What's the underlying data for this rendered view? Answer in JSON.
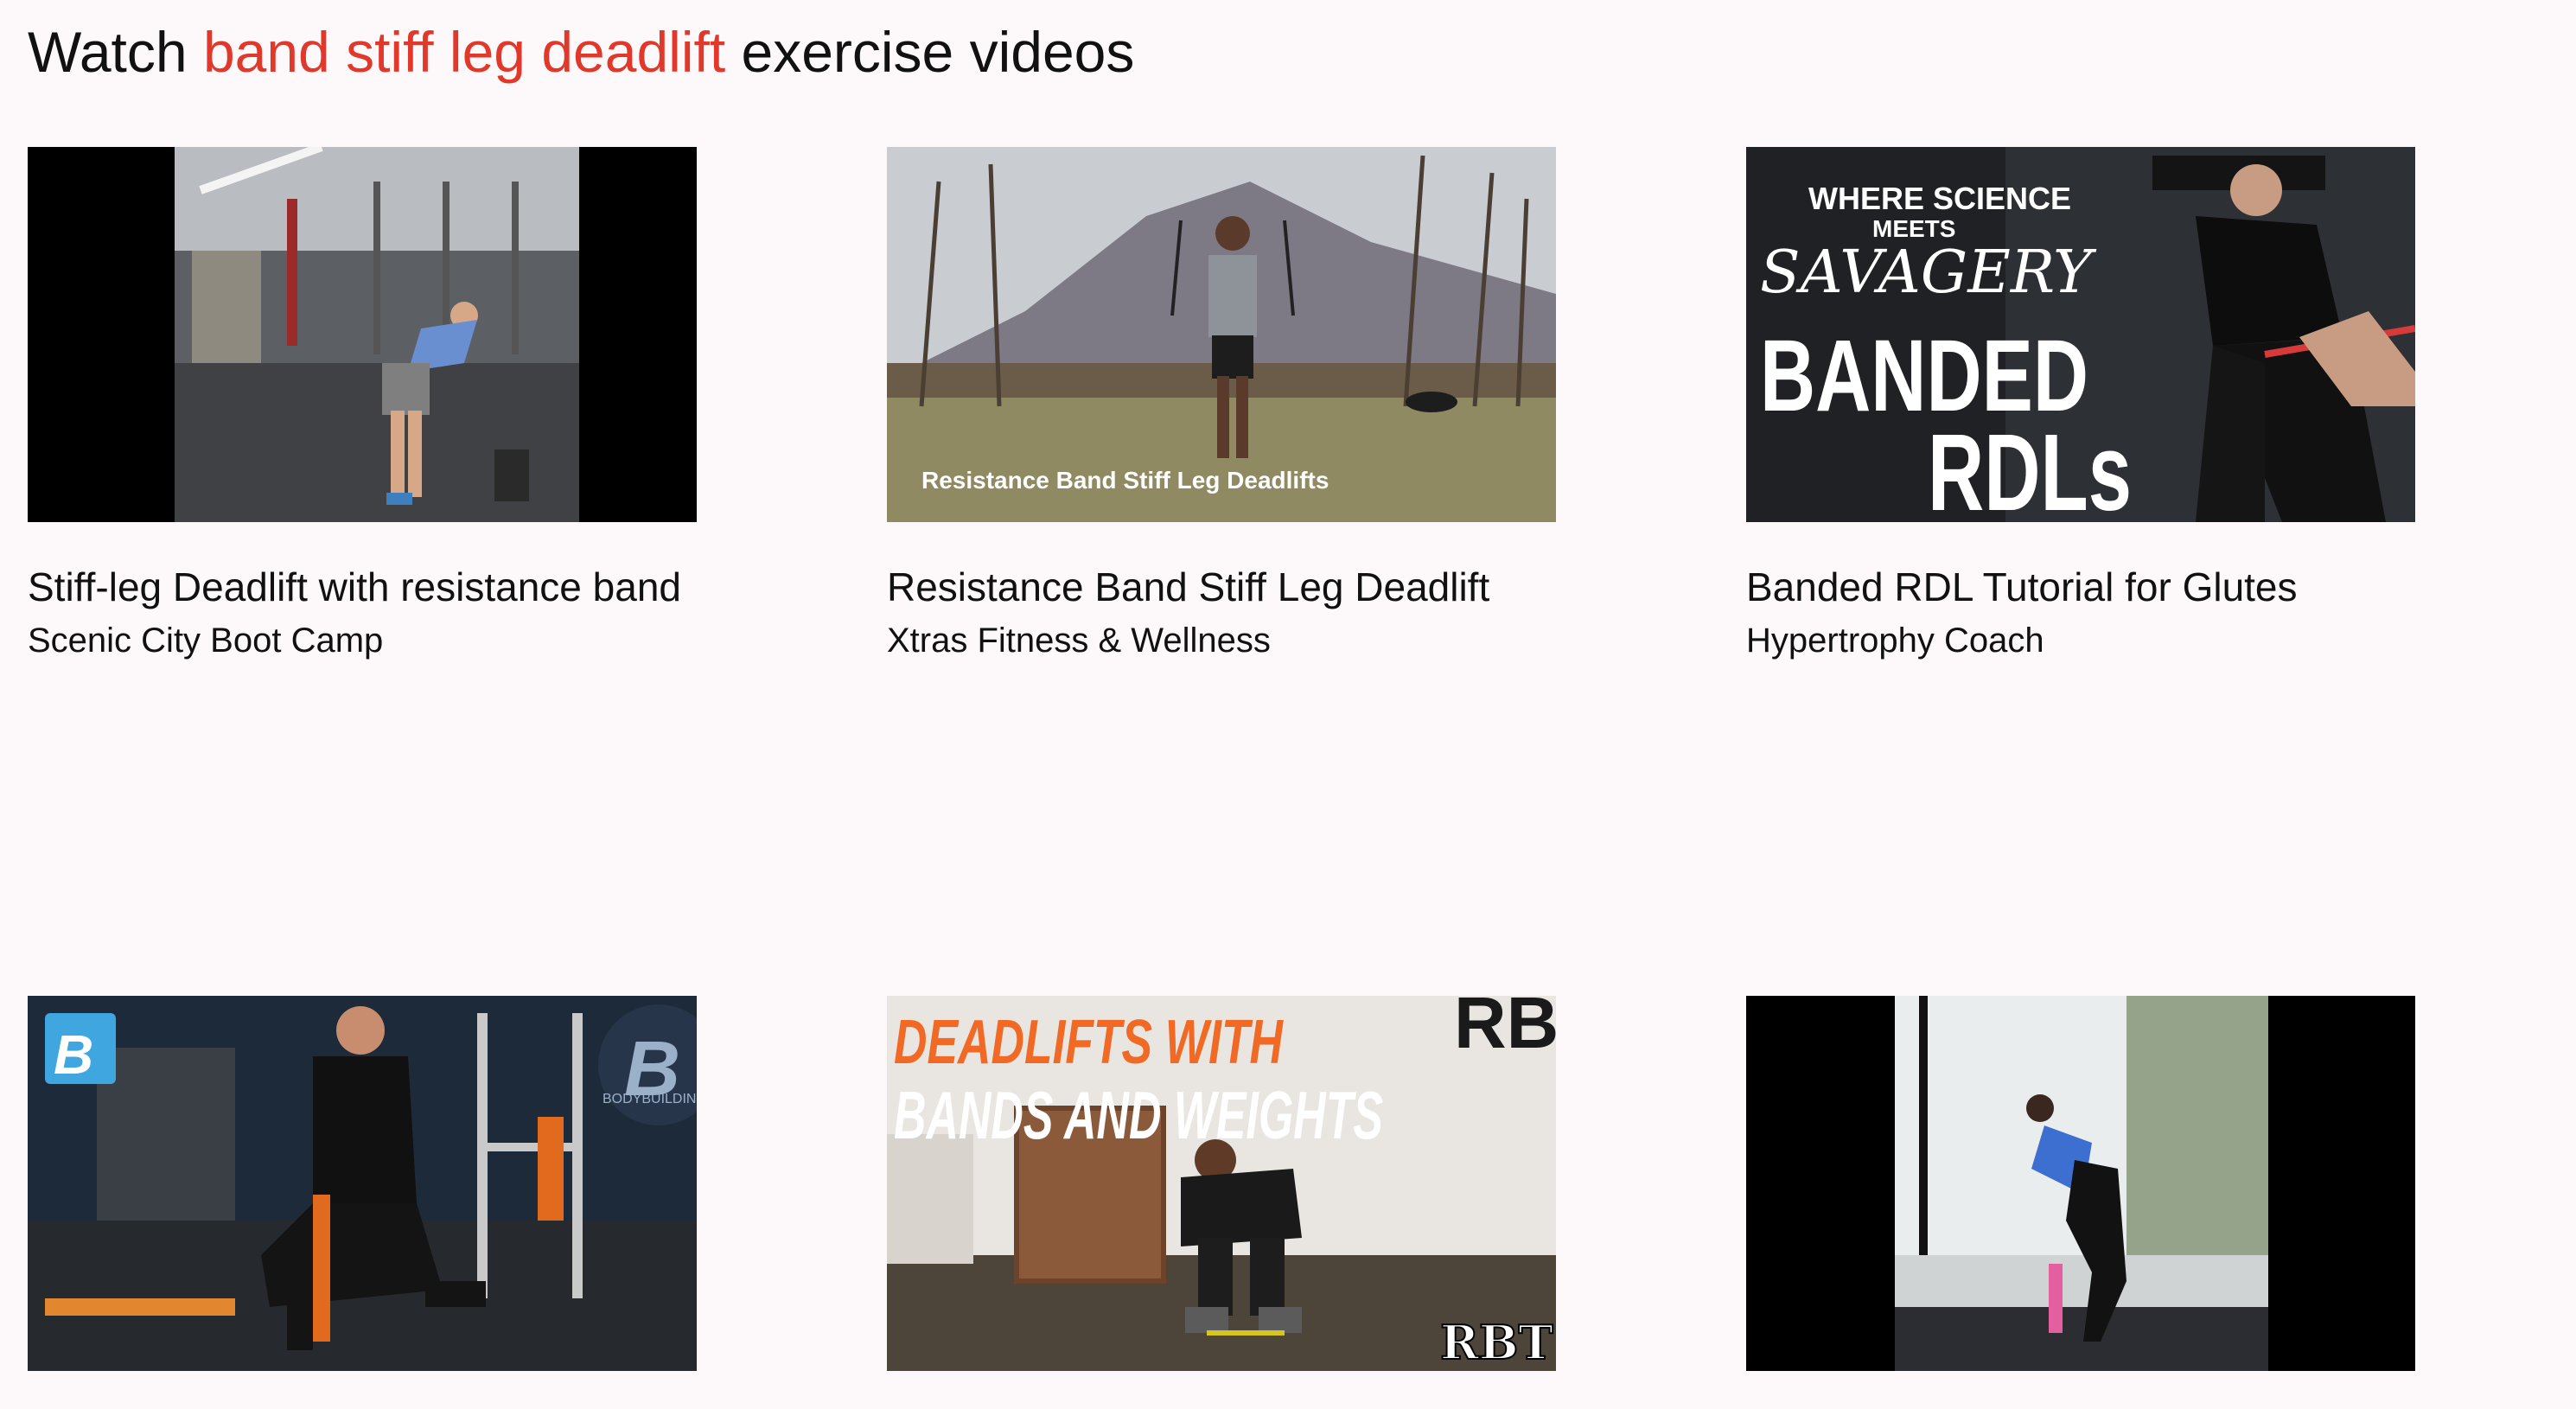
{
  "heading": {
    "prefix": "Watch ",
    "highlight": "band stiff leg deadlift",
    "suffix": " exercise videos",
    "highlight_color": "#e0392b"
  },
  "videos": [
    {
      "title": "Stiff-leg Deadlift with resistance band",
      "channel": "Scenic City Boot Camp"
    },
    {
      "title": "Resistance Band Stiff Leg Deadlift",
      "channel": "Xtras Fitness & Wellness",
      "overlay_text": "Resistance Band Stiff Leg Deadlifts"
    },
    {
      "title": "Banded RDL Tutorial for Glutes",
      "channel": "Hypertrophy Coach",
      "overlay_lines": [
        "WHERE SCIENCE",
        "MEETS",
        "SAVAGERY",
        "BANDED",
        "RDLs"
      ]
    },
    {
      "title": "",
      "channel": "",
      "overlay_logo": "B",
      "overlay_watermark": "BODYBUILDING"
    },
    {
      "title": "",
      "channel": "",
      "overlay_lines": [
        "DEADLIFTS WITH",
        "BANDS AND WEIGHTS"
      ],
      "overlay_brand": "RBT",
      "overlay_sign": "RBT"
    },
    {
      "title": "",
      "channel": ""
    }
  ]
}
